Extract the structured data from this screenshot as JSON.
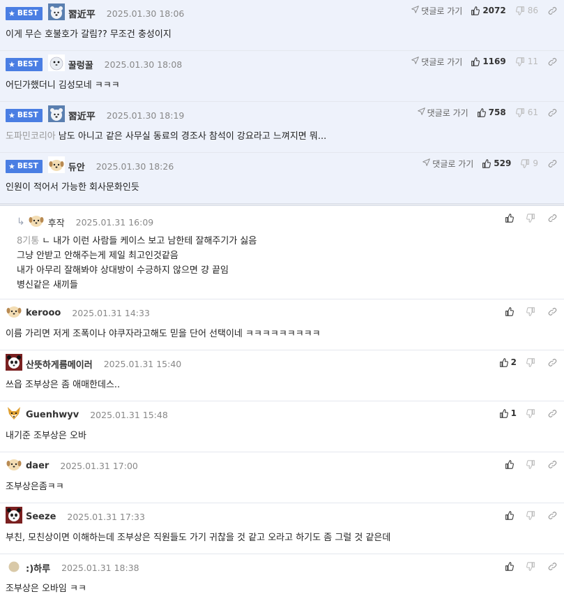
{
  "labels": {
    "best": "BEST",
    "goto": "댓글로 가기"
  },
  "best_comments": [
    {
      "nick": "習近平",
      "date": "2025.01.30 18:06",
      "text": "이게 무슨 호불호가 갈림?? 무조건 충성이지",
      "up": "2072",
      "down": "86",
      "avatar": "bear-avatar"
    },
    {
      "nick": "꿀렁꿀",
      "date": "2025.01.30 18:08",
      "text": "어딘가했더니 김성모네 ㅋㅋㅋ",
      "up": "1169",
      "down": "11",
      "avatar": "seal-avatar"
    },
    {
      "nick": "習近平",
      "date": "2025.01.30 18:19",
      "prefix": "도파민코리아",
      "text": "남도 아니고 같은 사무실 동료의 경조사 참석이 강요라고 느껴지면 뭐...",
      "up": "758",
      "down": "61",
      "avatar": "bear-avatar"
    },
    {
      "nick": "듀안",
      "date": "2025.01.30 18:26",
      "text": "인원이 적어서 가능한 회사문화인듯",
      "up": "529",
      "down": "9",
      "avatar": "dog-avatar"
    }
  ],
  "reply": {
    "nick": "후작",
    "date": "2025.01.31 16:09",
    "prefix": "8기통",
    "lines": [
      "ㄴ 내가 이런 사람들 케이스 보고 남한테 잘해주기가 싫음",
      "그냥 안받고 안해주는게 제일 최고인것같음",
      "내가 아무리 잘해봐야 상대방이 수긍하지 않으면 걍 끝임",
      "병신같은 새끼들"
    ],
    "avatar": "dog-avatar"
  },
  "comments": [
    {
      "nick": "kerooo",
      "date": "2025.01.31 14:33",
      "text": "이름 가리면 저게 조폭이나 야쿠자라고해도 믿을 단어 선택이네 ㅋㅋㅋㅋㅋㅋㅋㅋㅋ",
      "up": "",
      "avatar": "dog-avatar"
    },
    {
      "nick": "산뜻하게름메이러",
      "date": "2025.01.31 15:40",
      "text": "쓰읍 조부상은 좀 애매한데스..",
      "up": "2",
      "avatar": "panda-avatar"
    },
    {
      "nick": "Guenhwyv",
      "date": "2025.01.31 15:48",
      "text": "내기준 조부상은 오바",
      "up": "1",
      "avatar": "fox-avatar"
    },
    {
      "nick": "daer",
      "date": "2025.01.31 17:00",
      "text": "조부상은좀ㅋㅋ",
      "up": "",
      "avatar": "dog-avatar"
    },
    {
      "nick": "Seeze",
      "date": "2025.01.31 17:33",
      "text": "부친, 모친상이면 이해하는데 조부상은 직원들도 가기 귀찮을 것 같고 오라고 하기도 좀 그럴 것 같은데",
      "up": "",
      "avatar": "panda-avatar"
    },
    {
      "nick": ":)하루",
      "date": "2025.01.31 18:38",
      "text": "조부상은 오바임 ㅋㅋ",
      "up": "",
      "avatar": "dot-avatar"
    }
  ]
}
